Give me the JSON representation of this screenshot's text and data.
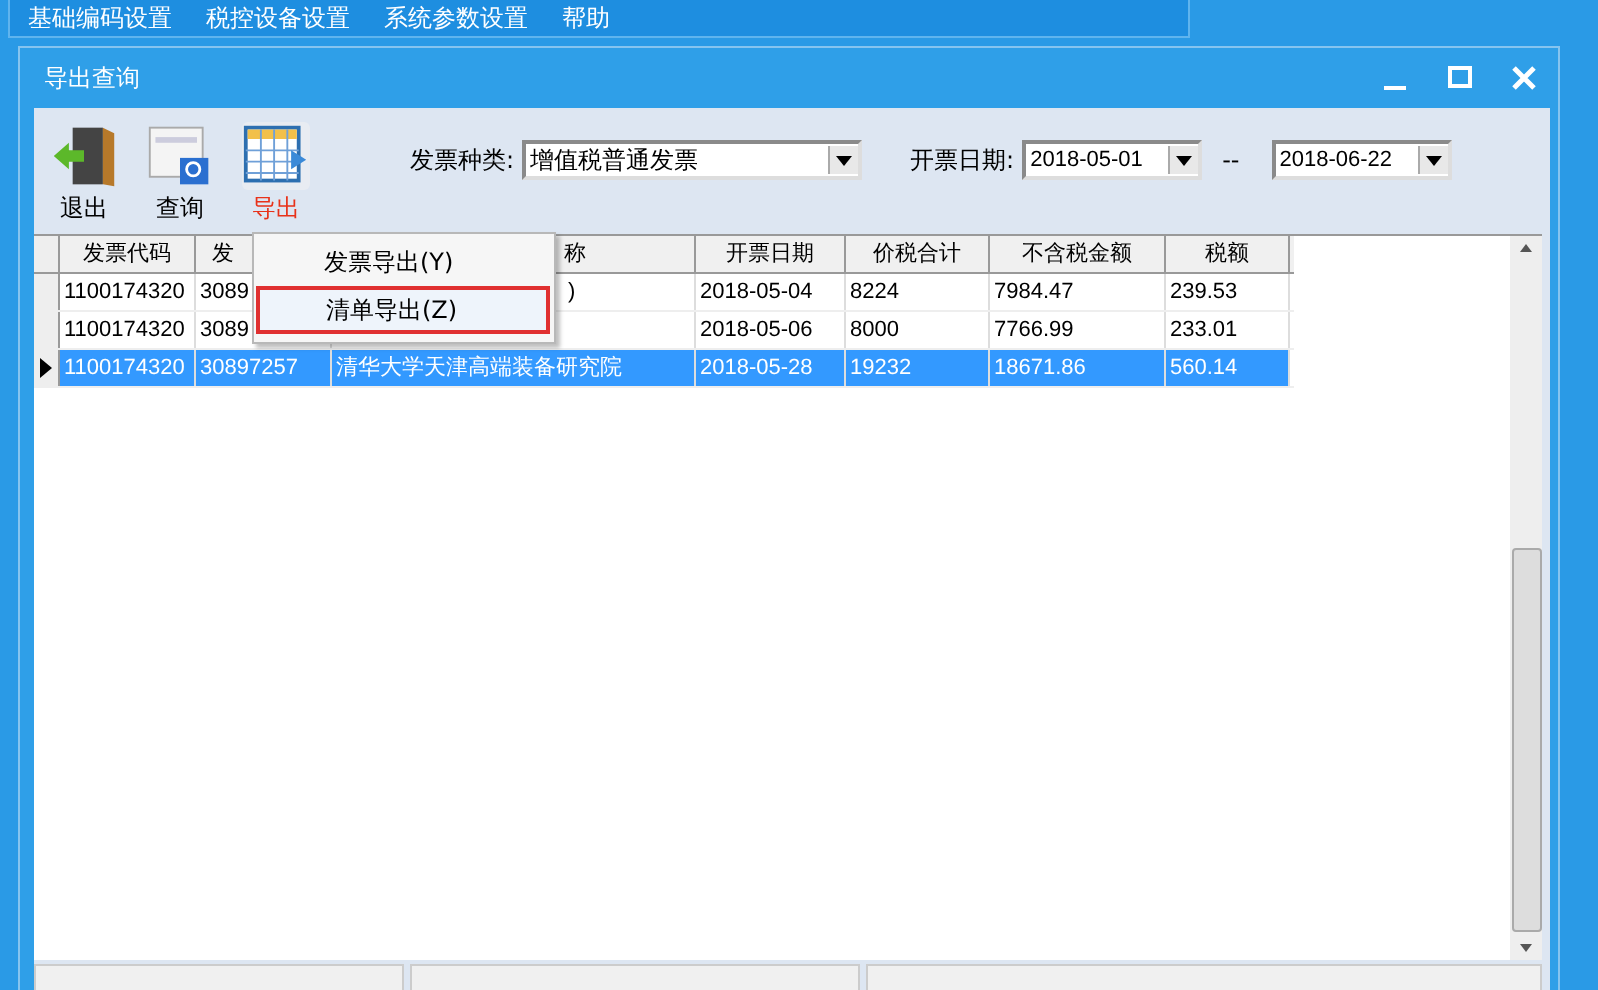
{
  "menu_bar": [
    "基础编码设置",
    "税控设备设置",
    "系统参数设置",
    "帮助"
  ],
  "window": {
    "title": "导出查询"
  },
  "toolbar": [
    {
      "label": "退出",
      "kind": "exit",
      "selected": false
    },
    {
      "label": "查询",
      "kind": "query",
      "selected": false
    },
    {
      "label": "导出",
      "kind": "export",
      "selected": true
    }
  ],
  "filters": {
    "invoice_type_label": "发票种类:",
    "invoice_type": "增值税普通发票",
    "date_label": "开票日期:",
    "date_from": "2018-05-01",
    "separator": "--",
    "date_to": "2018-06-22"
  },
  "table": {
    "columns": [
      "发票代码",
      "发",
      "称",
      "开票日期",
      "价税合计",
      "不含税金额",
      "税额"
    ],
    "rows": [
      {
        "selected": false,
        "cells": [
          "1100174320",
          "3089",
          ")",
          "2018-05-04",
          "8224",
          "7984.47",
          "239.53"
        ]
      },
      {
        "selected": false,
        "cells": [
          "1100174320",
          "3089",
          "",
          "2018-05-06",
          "8000",
          "7766.99",
          "233.01"
        ]
      },
      {
        "selected": true,
        "cells": [
          "1100174320",
          "30897257",
          "清华大学天津高端装备研究院",
          "2018-05-28",
          "19232",
          "18671.86",
          "560.14"
        ]
      }
    ]
  },
  "context_menu": [
    {
      "label": "发票导出(Y)",
      "selected": false
    },
    {
      "label": "清单导出(Z)",
      "selected": true
    }
  ]
}
